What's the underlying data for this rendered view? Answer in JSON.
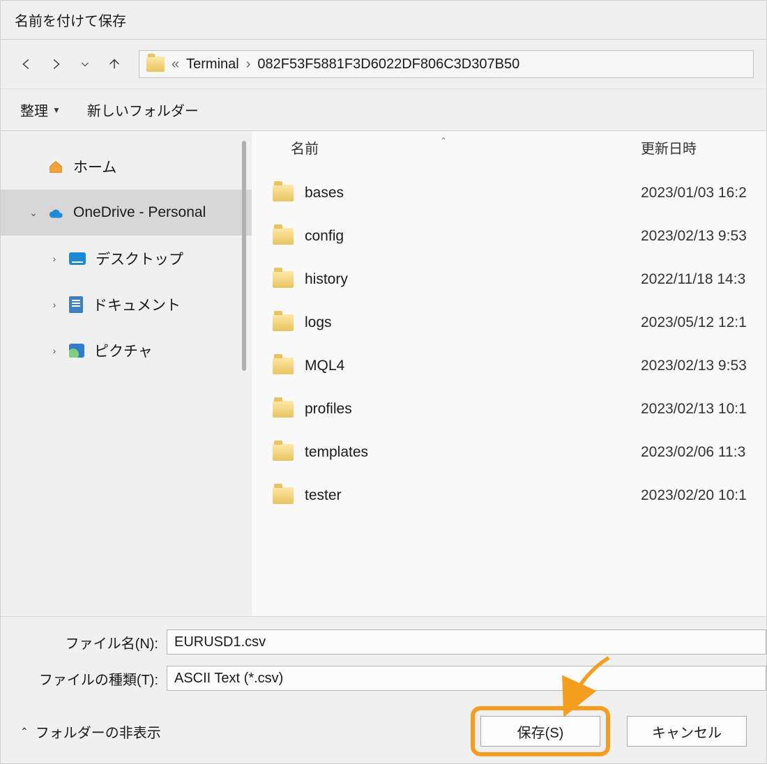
{
  "dialog": {
    "title": "名前を付けて保存"
  },
  "breadcrumb": {
    "prefix": "«",
    "parent": "Terminal",
    "current": "082F53F5881F3D6022DF806C3D307B50"
  },
  "toolbar": {
    "organize": "整理",
    "new_folder": "新しいフォルダー"
  },
  "sidebar": {
    "home": "ホーム",
    "onedrive": "OneDrive - Personal",
    "desktop": "デスクトップ",
    "documents": "ドキュメント",
    "pictures": "ピクチャ"
  },
  "columns": {
    "name": "名前",
    "modified": "更新日時"
  },
  "files": [
    {
      "name": "bases",
      "date": "2023/01/03 16:2"
    },
    {
      "name": "config",
      "date": "2023/02/13 9:53"
    },
    {
      "name": "history",
      "date": "2022/11/18 14:3"
    },
    {
      "name": "logs",
      "date": "2023/05/12 12:1"
    },
    {
      "name": "MQL4",
      "date": "2023/02/13 9:53"
    },
    {
      "name": "profiles",
      "date": "2023/02/13 10:1"
    },
    {
      "name": "templates",
      "date": "2023/02/06 11:3"
    },
    {
      "name": "tester",
      "date": "2023/02/20 10:1"
    }
  ],
  "fields": {
    "filename_label": "ファイル名(N):",
    "filename_value": "EURUSD1.csv",
    "filetype_label": "ファイルの種類(T):",
    "filetype_value": "ASCII Text (*.csv)"
  },
  "footer": {
    "hide_folders": "フォルダーの非表示",
    "save": "保存(S)",
    "cancel": "キャンセル"
  }
}
